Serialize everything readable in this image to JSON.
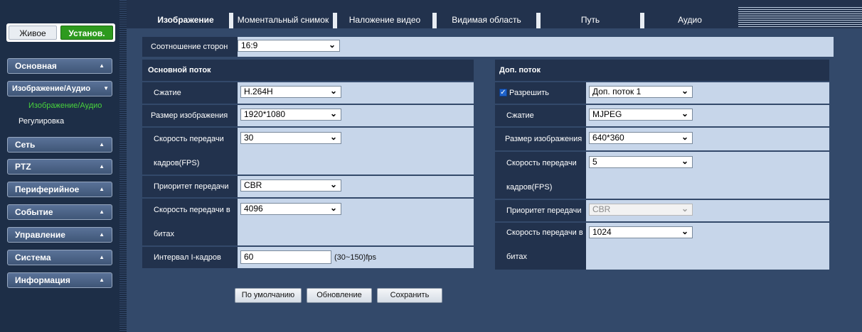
{
  "mode": {
    "live_label": "Живое",
    "setup_label": "Установ."
  },
  "sidebar": {
    "menus": [
      {
        "label": "Основная",
        "arrow": "▲"
      },
      {
        "label": "Изображение/Аудио",
        "arrow": "▼"
      },
      {
        "label": "Сеть",
        "arrow": "▲"
      },
      {
        "label": "PTZ",
        "arrow": "▲"
      },
      {
        "label": "Периферийное",
        "arrow": "▲"
      },
      {
        "label": "Событие",
        "arrow": "▲"
      },
      {
        "label": "Управление",
        "arrow": "▲"
      },
      {
        "label": "Система",
        "arrow": "▲"
      },
      {
        "label": "Информация",
        "arrow": "▲"
      }
    ],
    "subitems": [
      {
        "label": "Изображение/Аудио",
        "active": true
      },
      {
        "label": "Регулировка",
        "active": false
      }
    ]
  },
  "tabs": [
    {
      "label": "Изображение",
      "active": true
    },
    {
      "label": "Моментальный снимок",
      "active": false
    },
    {
      "label": "Наложение видео",
      "active": false
    },
    {
      "label": "Видимая область",
      "active": false
    },
    {
      "label": "Путь",
      "active": false
    },
    {
      "label": "Аудио",
      "active": false
    }
  ],
  "aspect": {
    "label": "Соотношение сторон",
    "value": "16:9"
  },
  "main_stream": {
    "title": "Основной поток",
    "compression": {
      "label": "Сжатие",
      "value": "H.264H"
    },
    "resolution": {
      "label": "Размер изображения",
      "value": "1920*1080"
    },
    "fps": {
      "label_line1": "Скорость передачи",
      "label_line2": "кадров(FPS)",
      "value": "30"
    },
    "priority": {
      "label": "Приоритет передачи",
      "value": "CBR"
    },
    "bitrate": {
      "label_line1": "Скорость передачи в",
      "label_line2": "битах",
      "value": "4096"
    },
    "iframe": {
      "label": "Интервал I-кадров",
      "value": "60",
      "hint": "(30~150)fps"
    }
  },
  "sub_stream": {
    "title": "Доп. поток",
    "enable": {
      "label": "Разрешить",
      "checked": true,
      "value": "Доп. поток 1"
    },
    "compression": {
      "label": "Сжатие",
      "value": "MJPEG"
    },
    "resolution": {
      "label": "Размер изображения",
      "value": "640*360"
    },
    "fps": {
      "label_line1": "Скорость передачи",
      "label_line2": "кадров(FPS)",
      "value": "5"
    },
    "priority": {
      "label": "Приоритет передачи",
      "value": "CBR",
      "disabled": true
    },
    "bitrate": {
      "label_line1": "Скорость передачи в",
      "label_line2": "битах",
      "value": "1024"
    }
  },
  "actions": {
    "default_label": "По умолчанию",
    "refresh_label": "Обновление",
    "save_label": "Сохранить"
  },
  "colors": {
    "setup_active": "#2d9a1e",
    "active_subitem": "#48d23c",
    "panel_dark": "#22324d",
    "panel_light": "#c7d6ea"
  }
}
